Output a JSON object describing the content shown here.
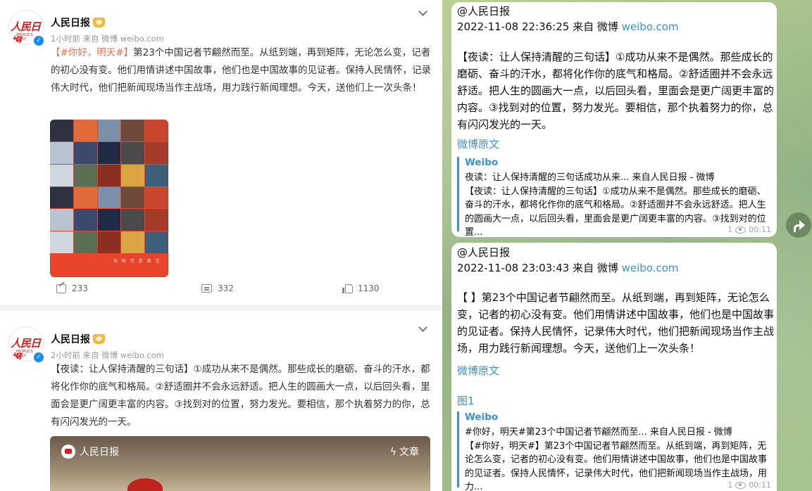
{
  "feed": {
    "posts": [
      {
        "author": "人民日报",
        "time": "1小时前",
        "source_prefix": "来自",
        "source": "微博 weibo.com",
        "tag": "【#你好，明天#】",
        "text": "第23个中国记者节翩然而至。从纸到端，再到矩阵，无论怎么变，记者的初心没有变。他们用情讲述中国故事，他们也是中国故事的见证者。保持人民情怀，记录伟大时代，他们把新闻现场当作主战场，用力践行新闻理想。今天，送他们上一次头条！",
        "image_caption": "为 时 代 存 掠 注",
        "shares": "233",
        "comments": "332",
        "likes": "1130"
      },
      {
        "author": "人民日报",
        "time": "2小时前",
        "source_prefix": "来自",
        "source": "微博 weibo.com",
        "text": "【夜读：让人保持清醒的三句话】①成功从来不是偶然。那些成长的磨砺、奋斗的汗水，都将化作你的底气和格局。②舒适圈并不会永远舒适。把人生的圆画大一点，以后回头看，里面会是更广阔更丰富的内容。③找到对的位置，努力发光。要相信，那个执着努力的你，总有闪闪发光的一天。",
        "card_author": "人民日报",
        "card_type": "文章"
      }
    ],
    "avatar_text": "人民日报",
    "avatar_sub": "PEOPLE'S DAILY"
  },
  "chat": {
    "messages": [
      {
        "handle": "@人民日报",
        "datetime": "2022-11-08 22:36:25 来自 微博",
        "link": "weibo.com",
        "body": "【夜读：让人保持清醒的三句话】①成功从来不是偶然。那些成长的磨砺、奋斗的汗水，都将化作你的底气和格局。②舒适圈并不会永远舒适。把人生的圆画大一点，以后回头看，里面会是更广阔更丰富的内容。③找到对的位置，努力发光。要相信，那个执着努力的你，总有闪闪发光的一天。",
        "original_link": "微博原文",
        "preview_site": "Weibo",
        "preview_title": "夜读：让人保持清醒的三句话成功从来... 来自人民日报 - 微博",
        "preview_text": "【夜读：让人保持清醒的三句话】①成功从来不是偶然。那些成长的磨砺、奋斗的汗水，都将化作你的底气和格局。②舒适圈并不会永远舒适。把人生的圆画大一点，以后回头看，里面会是更广阔更丰富的内容。③找到对的位置...",
        "views": "1",
        "time": "00:11"
      },
      {
        "handle": "@人民日报",
        "datetime": "2022-11-08 23:03:43 来自 微博",
        "link": "weibo.com",
        "body": "【 】第23个中国记者节翩然而至。从纸到端，再到矩阵，无论怎么变，记者的初心没有变。他们用情讲述中国故事，他们也是中国故事的见证者。保持人民情怀，记录伟大时代，他们把新闻现场当作主战场，用力践行新闻理想。今天，送他们上一次头条！",
        "original_link": "微博原文",
        "image_link": "图1",
        "preview_site": "Weibo",
        "preview_title": "#你好，明天#第23个中国记者节翩然而至... 来自人民日报 - 微博",
        "preview_text": "【#你好，明天#】第23个中国记者节翩然而至。从纸到端，再到矩阵，无论怎么变，记者的初心没有变。他们用情讲述中国故事，他们也是中国故事的见证者。保持人民情怀，记录伟大时代，他们把新闻现场当作主战场，用力...",
        "views": "1",
        "time": "00:11"
      }
    ]
  },
  "colors": {
    "accent_link": "#3a8fd6",
    "tag": "#eb7350",
    "brand_red": "#d61d1d"
  },
  "icons": [
    "chevron-down-icon",
    "verified-icon",
    "crown-icon",
    "share-icon",
    "comment-icon",
    "like-icon",
    "eye-icon",
    "forward-icon",
    "bolt-icon"
  ]
}
